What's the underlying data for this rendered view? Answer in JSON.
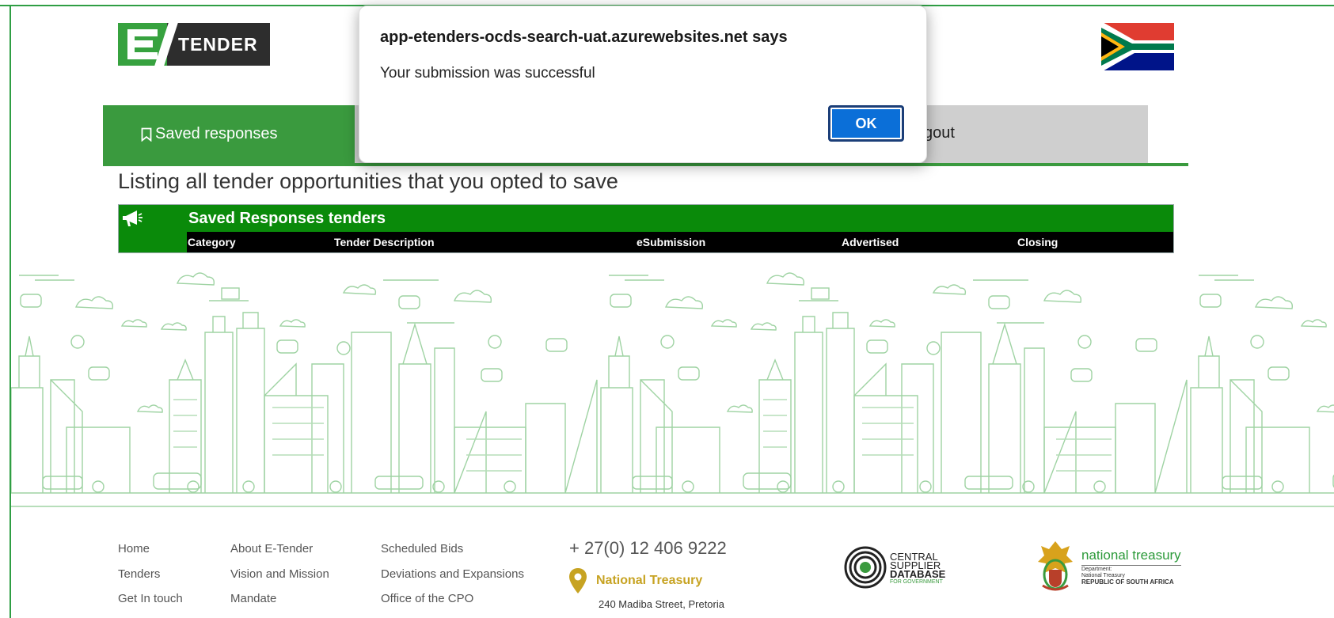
{
  "header": {
    "logo_text": "TENDER",
    "flag_icon": "south-africa-flag-icon"
  },
  "nav": {
    "active_label": "Saved responses",
    "logout_label": "gout"
  },
  "main": {
    "listing_text": "Listing all tender opportunities that you opted to save",
    "table": {
      "title": "Saved Responses tenders",
      "columns": [
        "Category",
        "Tender Description",
        "eSubmission",
        "Advertised",
        "Closing"
      ]
    }
  },
  "footer": {
    "col1": [
      "Home",
      "Tenders",
      "Get In touch"
    ],
    "col2": [
      "About E-Tender",
      "Vision and Mission",
      "Mandate"
    ],
    "col3": [
      "Scheduled Bids",
      "Deviations and Expansions",
      "Office of the CPO"
    ],
    "phone": "+ 27(0) 12 406 9222",
    "org_name": "National Treasury",
    "address": "240 Madiba Street, Pretoria",
    "csd": {
      "line1": "CENTRAL SUPPLIER",
      "line2": "DATABASE",
      "line3": "FOR GOVERNMENT"
    },
    "treasury": {
      "name": "national treasury",
      "sub1": "Department:",
      "sub2": "National Treasury",
      "sub3": "REPUBLIC OF SOUTH AFRICA"
    }
  },
  "dialog": {
    "title": "app-etenders-ocds-search-uat.azurewebsites.net says",
    "message": "Your submission was successful",
    "ok_label": "OK"
  },
  "colors": {
    "brand_green": "#3a9a3e",
    "table_green": "#0a8a0a",
    "ok_blue": "#0b6fd8",
    "gold": "#c7a322"
  }
}
